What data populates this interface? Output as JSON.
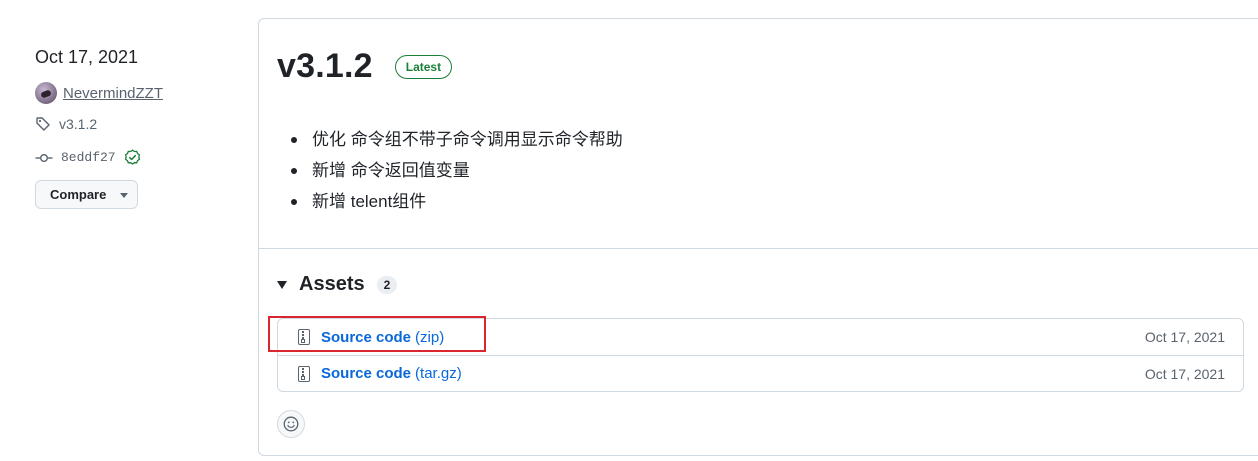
{
  "sidebar": {
    "date": "Oct 17, 2021",
    "author": "NevermindZZT",
    "tag": "v3.1.2",
    "commit": "8eddf27",
    "compare_label": "Compare"
  },
  "release": {
    "version": "v3.1.2",
    "badge": "Latest",
    "notes": [
      "优化 命令组不带子命令调用显示命令帮助",
      "新增 命令返回值变量",
      "新增 telent组件"
    ]
  },
  "assets": {
    "title": "Assets",
    "count": "2",
    "items": [
      {
        "name": "Source code",
        "ext": "(zip)",
        "date": "Oct 17, 2021"
      },
      {
        "name": "Source code",
        "ext": "(tar.gz)",
        "date": "Oct 17, 2021"
      }
    ]
  },
  "icons": {
    "avatar": "avatar",
    "tag": "tag-icon",
    "commit": "git-commit-icon",
    "verified": "verified-check-icon",
    "caret": "triangle-down-icon",
    "zip": "file-zip-icon",
    "smiley": "smiley-icon"
  },
  "colors": {
    "link": "#0969da",
    "latest": "#1a7f37",
    "highlight": "#d9262f",
    "muted": "#59636e"
  }
}
